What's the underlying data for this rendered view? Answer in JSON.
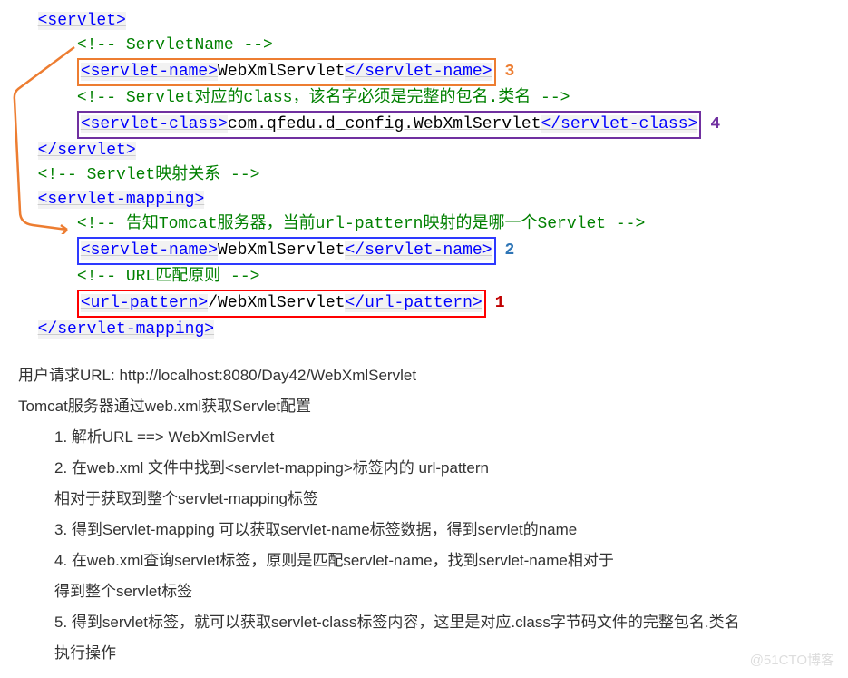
{
  "code": {
    "l1": "<servlet>",
    "l2": "    <!-- ServletName -->",
    "l3_open": "<servlet-name>",
    "l3_text": "WebXmlServlet",
    "l3_close": "</servlet-name>",
    "l3_num": "3",
    "l4": "    <!-- Servlet对应的class，该名字必须是完整的包名.类名 -->",
    "l5_open": "<servlet-class>",
    "l5_text": "com.qfedu.d_config.WebXmlServlet",
    "l5_close": "</servlet-class>",
    "l5_num": "4",
    "l6": "</servlet>",
    "l7": "<!-- Servlet映射关系 -->",
    "l8": "<servlet-mapping>",
    "l9": "    <!-- 告知Tomcat服务器，当前url-pattern映射的是哪一个Servlet -->",
    "l10_open": "<servlet-name>",
    "l10_text": "WebXmlServlet",
    "l10_close": "</servlet-name>",
    "l10_num": "2",
    "l11": "    <!-- URL匹配原则 -->",
    "l12_open": "<url-pattern>",
    "l12_text": "/WebXmlServlet",
    "l12_close": "</url-pattern>",
    "l12_num": "1",
    "l13": "</servlet-mapping>"
  },
  "explain": {
    "p1": "用户请求URL: http://localhost:8080/Day42/WebXmlServlet",
    "p2": "Tomcat服务器通过web.xml获取Servlet配置",
    "s1": "1. 解析URL ==> WebXmlServlet",
    "s2": "2. 在web.xml 文件中找到<servlet-mapping>标签内的 url-pattern",
    "s2b": "相对于获取到整个servlet-mapping标签",
    "s3": "3. 得到Servlet-mapping 可以获取servlet-name标签数据，得到servlet的name",
    "s4": "4. 在web.xml查询servlet标签，原则是匹配servlet-name，找到servlet-name相对于",
    "s4b": "得到整个servlet标签",
    "s5": "5. 得到servlet标签，就可以获取servlet-class标签内容，这里是对应.class字节码文件的完整包名.类名",
    "s5b": "执行操作"
  },
  "watermark": "@51CTO博客"
}
